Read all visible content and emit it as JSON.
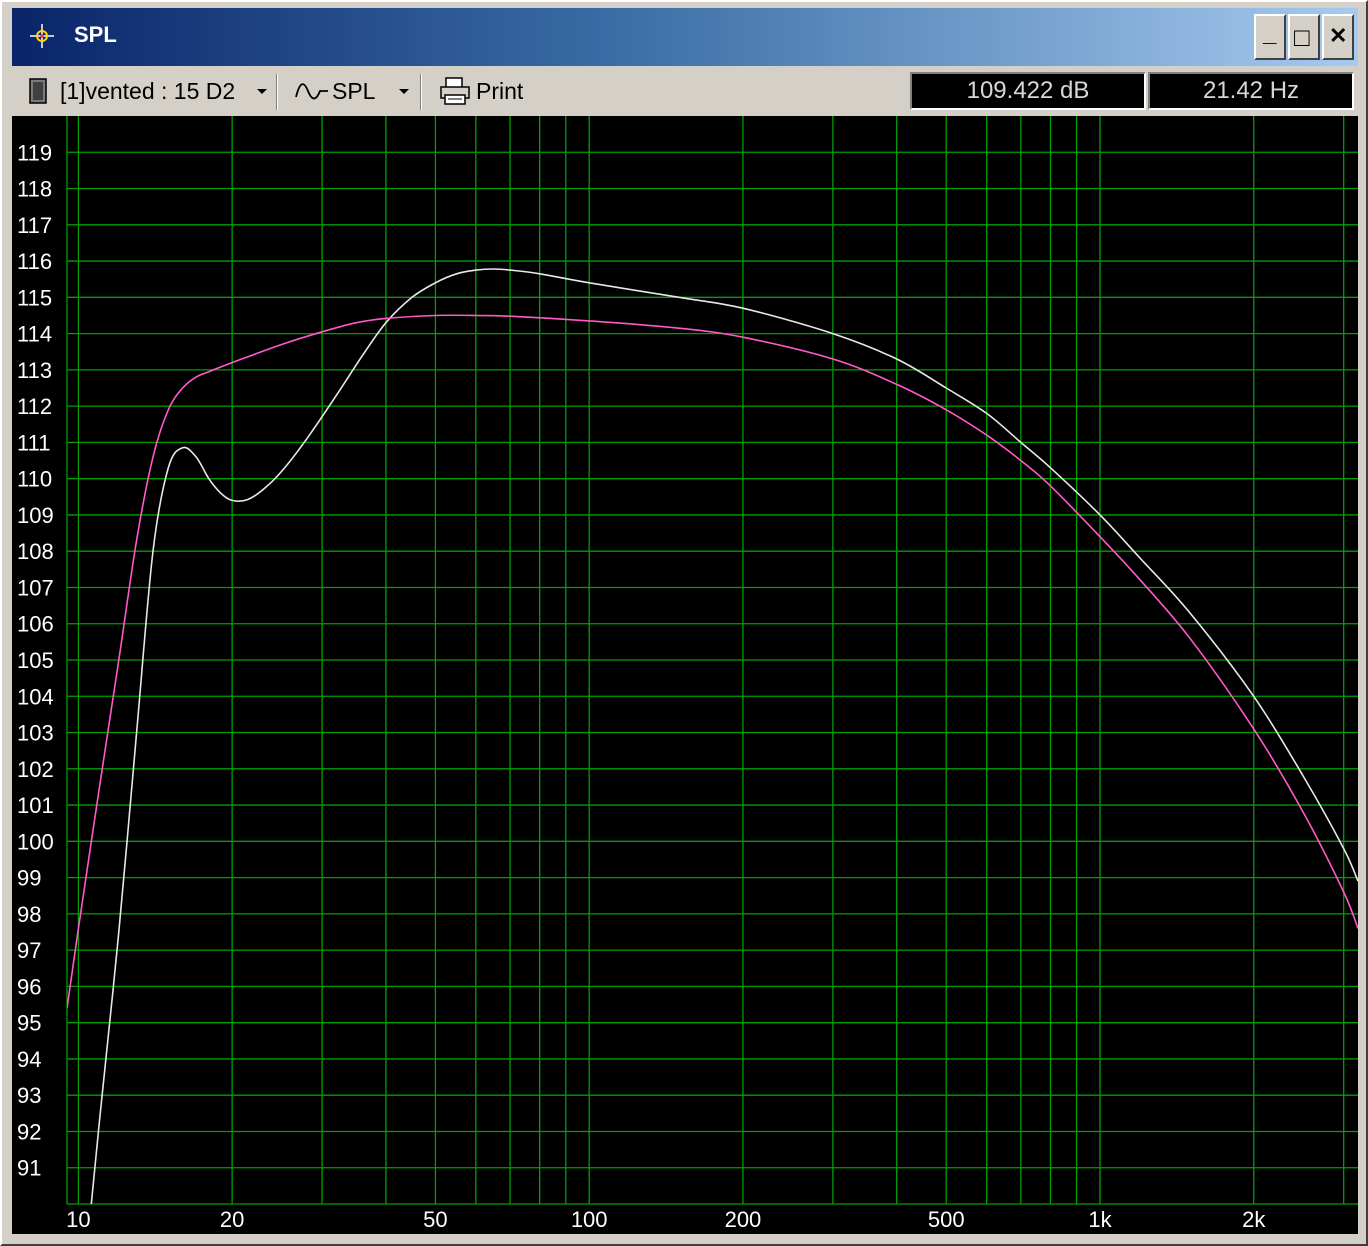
{
  "window": {
    "title": "SPL",
    "buttons": {
      "minimize": "_",
      "maximize": "□",
      "close": "✕"
    }
  },
  "toolbar": {
    "driver_label": "[1]vented : 15 D2",
    "graph_label": "SPL",
    "print_label": "Print",
    "readout_db": "109.422 dB",
    "readout_hz": "21.42 Hz"
  },
  "colors": {
    "grid": "#00a000",
    "series_white": "#e8e8e8",
    "series_pink": "#ff5ac8",
    "background": "#000000"
  },
  "chart_data": {
    "type": "line",
    "title": "",
    "xlabel": "",
    "ylabel": "",
    "x_scale": "log",
    "xlim": [
      9.5,
      3200
    ],
    "ylim": [
      90,
      120
    ],
    "x_ticks": [
      {
        "v": 10,
        "label": "10"
      },
      {
        "v": 20,
        "label": "20"
      },
      {
        "v": 50,
        "label": "50"
      },
      {
        "v": 100,
        "label": "100"
      },
      {
        "v": 200,
        "label": "200"
      },
      {
        "v": 500,
        "label": "500"
      },
      {
        "v": 1000,
        "label": "1k"
      },
      {
        "v": 2000,
        "label": "2k"
      }
    ],
    "y_ticks": [
      91,
      92,
      93,
      94,
      95,
      96,
      97,
      98,
      99,
      100,
      101,
      102,
      103,
      104,
      105,
      106,
      107,
      108,
      109,
      110,
      111,
      112,
      113,
      114,
      115,
      116,
      117,
      118,
      119
    ],
    "grid": true,
    "series": [
      {
        "color": "#e8e8e8",
        "points": [
          [
            10.6,
            90
          ],
          [
            11,
            92.3
          ],
          [
            12,
            97.5
          ],
          [
            13,
            103
          ],
          [
            14,
            108
          ],
          [
            15,
            110.3
          ],
          [
            16,
            110.85
          ],
          [
            17,
            110.6
          ],
          [
            18,
            110
          ],
          [
            19,
            109.6
          ],
          [
            20,
            109.4
          ],
          [
            21.4,
            109.42
          ],
          [
            23,
            109.7
          ],
          [
            25,
            110.2
          ],
          [
            28,
            111.1
          ],
          [
            32,
            112.3
          ],
          [
            36,
            113.4
          ],
          [
            40,
            114.3
          ],
          [
            45,
            115
          ],
          [
            50,
            115.4
          ],
          [
            55,
            115.65
          ],
          [
            60,
            115.75
          ],
          [
            65,
            115.78
          ],
          [
            70,
            115.75
          ],
          [
            80,
            115.65
          ],
          [
            100,
            115.4
          ],
          [
            150,
            115
          ],
          [
            200,
            114.7
          ],
          [
            300,
            114
          ],
          [
            400,
            113.3
          ],
          [
            500,
            112.5
          ],
          [
            600,
            111.8
          ],
          [
            700,
            111
          ],
          [
            800,
            110.3
          ],
          [
            1000,
            109
          ],
          [
            1200,
            107.8
          ],
          [
            1500,
            106.3
          ],
          [
            2000,
            104
          ],
          [
            2500,
            101.8
          ],
          [
            3000,
            99.8
          ],
          [
            3200,
            98.9
          ]
        ]
      },
      {
        "color": "#ff5ac8",
        "points": [
          [
            9.5,
            95.4
          ],
          [
            10,
            97.6
          ],
          [
            11,
            101.5
          ],
          [
            12,
            105
          ],
          [
            13,
            108.3
          ],
          [
            14,
            110.6
          ],
          [
            15,
            111.9
          ],
          [
            16,
            112.5
          ],
          [
            17,
            112.8
          ],
          [
            18,
            112.95
          ],
          [
            20,
            113.2
          ],
          [
            25,
            113.7
          ],
          [
            30,
            114.05
          ],
          [
            35,
            114.3
          ],
          [
            40,
            114.42
          ],
          [
            50,
            114.5
          ],
          [
            60,
            114.5
          ],
          [
            70,
            114.48
          ],
          [
            100,
            114.35
          ],
          [
            150,
            114.15
          ],
          [
            200,
            113.9
          ],
          [
            300,
            113.3
          ],
          [
            400,
            112.6
          ],
          [
            500,
            111.9
          ],
          [
            600,
            111.2
          ],
          [
            700,
            110.5
          ],
          [
            800,
            109.8
          ],
          [
            1000,
            108.4
          ],
          [
            1200,
            107.2
          ],
          [
            1500,
            105.6
          ],
          [
            2000,
            103.1
          ],
          [
            2500,
            100.8
          ],
          [
            3000,
            98.6
          ],
          [
            3200,
            97.6
          ]
        ]
      }
    ]
  }
}
